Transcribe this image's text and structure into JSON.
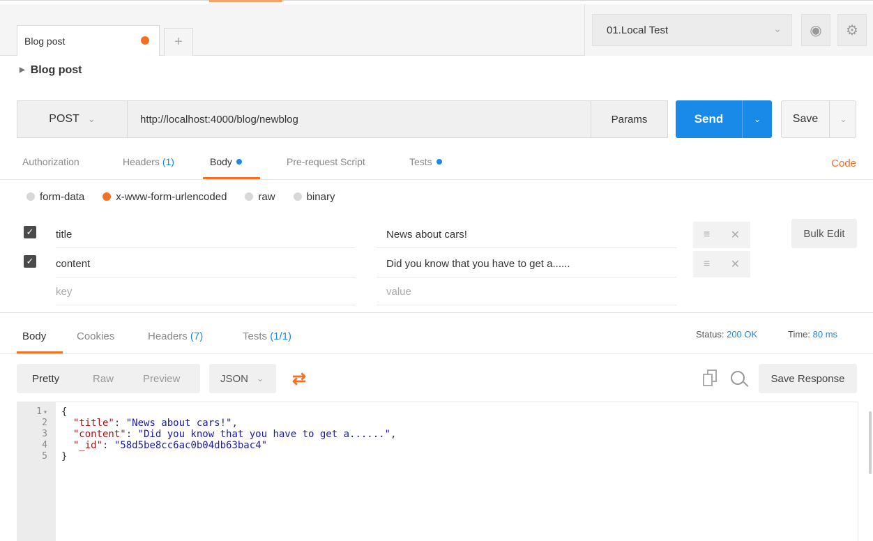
{
  "tabs": [
    {
      "label": "Blog post",
      "unsaved": true
    }
  ],
  "new_tab_label": "+",
  "environment": {
    "selected": "01.Local Test"
  },
  "request": {
    "name": "Blog post",
    "method": "POST",
    "url": "http://localhost:4000/blog/newblog",
    "params_label": "Params",
    "send_label": "Send",
    "save_label": "Save"
  },
  "request_tabs": {
    "authorization": "Authorization",
    "headers": "Headers",
    "headers_count": "(1)",
    "body": "Body",
    "prerequest": "Pre-request Script",
    "tests": "Tests",
    "code": "Code"
  },
  "body_types": [
    "form-data",
    "x-www-form-urlencoded",
    "raw",
    "binary"
  ],
  "body_type_selected": "x-www-form-urlencoded",
  "params": [
    {
      "key": "title",
      "value": "News about cars!",
      "checked": true
    },
    {
      "key": "content",
      "value": "Did you know that you have to get a......",
      "checked": true
    }
  ],
  "placeholders": {
    "key": "key",
    "value": "value"
  },
  "bulk_edit_label": "Bulk Edit",
  "response": {
    "tabs": {
      "body": "Body",
      "cookies": "Cookies",
      "headers": "Headers",
      "headers_count": "(7)",
      "tests": "Tests",
      "tests_count": "(1/1)"
    },
    "status_label": "Status:",
    "status_value": "200 OK",
    "time_label": "Time:",
    "time_value": "80 ms",
    "views": [
      "Pretty",
      "Raw",
      "Preview"
    ],
    "format": "JSON",
    "save_response_label": "Save Response",
    "line_numbers": [
      "1",
      "2",
      "3",
      "4",
      "5"
    ],
    "code": {
      "open": "{",
      "lines": [
        {
          "key": "\"title\"",
          "sep": ": ",
          "value": "\"News about cars!\"",
          "end": ","
        },
        {
          "key": "\"content\"",
          "sep": ": ",
          "value": "\"Did you know that you have to get a......\"",
          "end": ","
        },
        {
          "key": "\"_id\"",
          "sep": ": ",
          "value": "\"58d5be8cc6ac0b04db63bac4\"",
          "end": ""
        }
      ],
      "close": "}"
    }
  },
  "icons": {
    "tab_dot": "unsaved-dot-icon",
    "env_chevron": "chevron-down-icon",
    "eye": "eye-icon",
    "settings": "gear-icon",
    "wrap": "wrap-lines-icon",
    "copy": "copy-icon",
    "search": "search-icon"
  },
  "colors": {
    "accent": "#f47023",
    "primary": "#1a8ae8"
  }
}
